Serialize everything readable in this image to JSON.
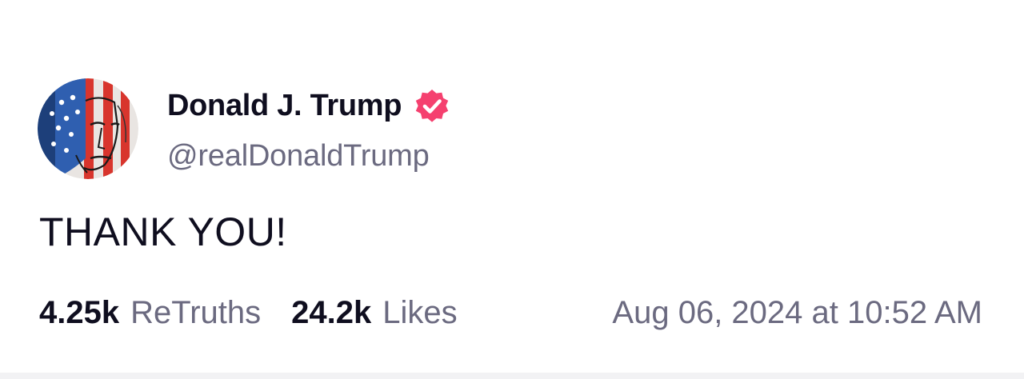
{
  "post": {
    "author": {
      "display_name": "Donald J. Trump",
      "handle": "@realDonaldTrump",
      "verified": true,
      "verified_badge_color": "#f5406f",
      "avatar": "avatar-image"
    },
    "text": "THANK YOU!",
    "stats": {
      "retruths_count": "4.25k",
      "retruths_label": "ReTruths",
      "likes_count": "24.2k",
      "likes_label": "Likes"
    },
    "timestamp": "Aug 06, 2024 at 10:52 AM"
  },
  "colors": {
    "text_primary": "#0f0e1f",
    "text_secondary": "#6b6a80",
    "background": "#ffffff"
  }
}
